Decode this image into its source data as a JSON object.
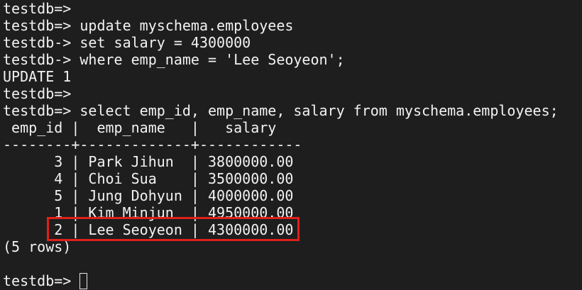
{
  "terminal": {
    "lines": [
      "testdb=>",
      "testdb=> update myschema.employees",
      "testdb-> set salary = 4300000",
      "testdb-> where emp_name = 'Lee Seoyeon';",
      "UPDATE 1",
      "testdb=>",
      "testdb=> select emp_id, emp_name, salary from myschema.employees;"
    ],
    "table": {
      "header": " emp_id |  emp_name   |   salary",
      "separator": "--------+-------------+------------",
      "rows": [
        "      3 | Park Jihun  | 3800000.00",
        "      4 | Choi Sua    | 3500000.00",
        "      5 | Jung Dohyun | 4000000.00",
        "      1 | Kim Minjun  | 4950000.00",
        "      2 | Lee Seoyeon | 4300000.00"
      ],
      "footer": "(5 rows)"
    },
    "blank": "",
    "final_prompt": "testdb=> ",
    "highlight_color": "#e0201a"
  }
}
